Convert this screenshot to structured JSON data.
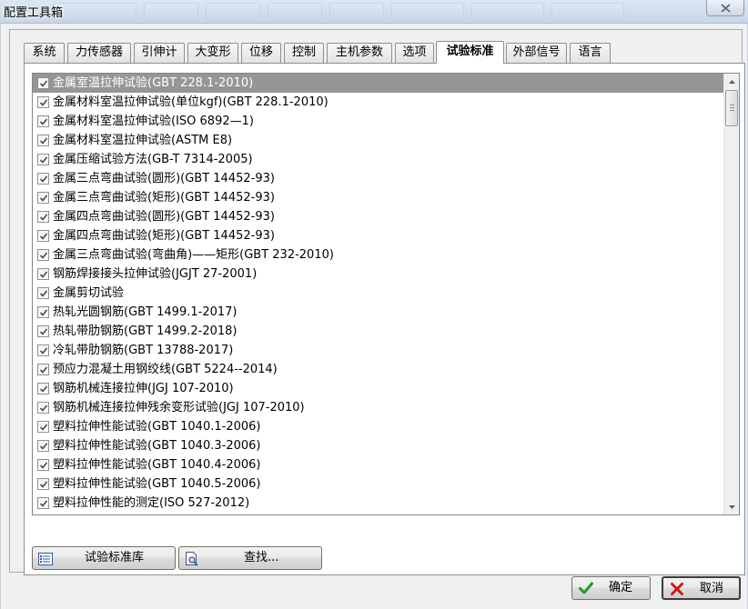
{
  "window": {
    "title": "配置工具箱",
    "close_icon": "close-icon"
  },
  "tabs": [
    {
      "label": "系统",
      "active": false
    },
    {
      "label": "力传感器",
      "active": false
    },
    {
      "label": "引伸计",
      "active": false
    },
    {
      "label": "大变形",
      "active": false
    },
    {
      "label": "位移",
      "active": false
    },
    {
      "label": "控制",
      "active": false
    },
    {
      "label": "主机参数",
      "active": false
    },
    {
      "label": "选项",
      "active": false
    },
    {
      "label": "试验标准",
      "active": true
    },
    {
      "label": "外部信号",
      "active": false
    },
    {
      "label": "语言",
      "active": false
    }
  ],
  "standards": [
    {
      "label": "金属室温拉伸试验(GBT 228.1-2010)",
      "checked": true,
      "selected": true
    },
    {
      "label": "金属材料室温拉伸试验(单位kgf)(GBT 228.1-2010)",
      "checked": true
    },
    {
      "label": "金属材料室温拉伸试验(ISO 6892—1)",
      "checked": true
    },
    {
      "label": "金属材料室温拉伸试验(ASTM E8)",
      "checked": true
    },
    {
      "label": "金属压缩试验方法(GB-T 7314-2005)",
      "checked": true
    },
    {
      "label": "金属三点弯曲试验(圆形)(GBT 14452-93)",
      "checked": true
    },
    {
      "label": "金属三点弯曲试验(矩形)(GBT 14452-93)",
      "checked": true
    },
    {
      "label": "金属四点弯曲试验(圆形)(GBT 14452-93)",
      "checked": true
    },
    {
      "label": "金属四点弯曲试验(矩形)(GBT 14452-93)",
      "checked": true
    },
    {
      "label": "金属三点弯曲试验(弯曲角)——矩形(GBT 232-2010)",
      "checked": true
    },
    {
      "label": "钢筋焊接接头拉伸试验(JGJT 27-2001)",
      "checked": true
    },
    {
      "label": "金属剪切试验",
      "checked": true
    },
    {
      "label": "热轧光圆钢筋(GBT 1499.1-2017)",
      "checked": true
    },
    {
      "label": "热轧带肋钢筋(GBT 1499.2-2018)",
      "checked": true
    },
    {
      "label": "冷轧带肋钢筋(GBT 13788-2017)",
      "checked": true
    },
    {
      "label": "预应力混凝土用钢绞线(GBT 5224--2014)",
      "checked": true
    },
    {
      "label": "钢筋机械连接拉伸(JGJ 107-2010)",
      "checked": true
    },
    {
      "label": "钢筋机械连接拉伸残余变形试验(JGJ 107-2010)",
      "checked": true
    },
    {
      "label": "塑料拉伸性能试验(GBT 1040.1-2006)",
      "checked": true
    },
    {
      "label": "塑料拉伸性能试验(GBT 1040.3-2006)",
      "checked": true
    },
    {
      "label": "塑料拉伸性能试验(GBT 1040.4-2006)",
      "checked": true
    },
    {
      "label": "塑料拉伸性能试验(GBT 1040.5-2006)",
      "checked": true
    },
    {
      "label": "塑料拉伸性能的测定(ISO 527-2012)",
      "checked": true
    }
  ],
  "buttons": {
    "library": "试验标准库",
    "find": "查找...",
    "ok": "确定",
    "cancel": "取消"
  },
  "colors": {
    "selected_row": "#969696",
    "ok_icon": "#1e9b2a",
    "cancel_icon": "#d01616"
  }
}
